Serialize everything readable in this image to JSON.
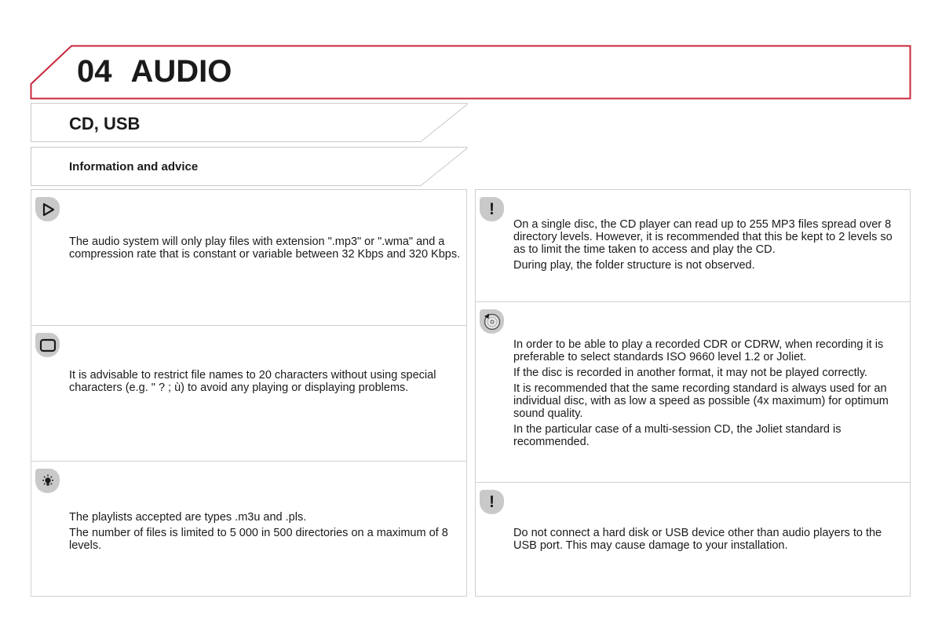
{
  "chapter": {
    "number": "04",
    "title": "AUDIO",
    "accent_color": "#c8283c"
  },
  "section": {
    "title": "CD, USB"
  },
  "subsection": {
    "title": "Information and advice"
  },
  "left_panels": [
    {
      "icon": "play-triangle-icon",
      "paragraphs": [
        "The audio system will only play files with extension \".mp3\" or \".wma\" and a compression rate that is constant or variable between 32 Kbps and 320 Kbps."
      ]
    },
    {
      "icon": "rounded-square-icon",
      "paragraphs": [
        "It is advisable to restrict file names to 20 characters without using special characters (e.g. \" ? ; ù) to avoid any playing or displaying problems."
      ]
    },
    {
      "icon": "lightbulb-icon",
      "paragraphs": [
        "The playlists accepted are types .m3u and .pls.",
        "The number of files is limited to 5 000 in 500 directories on a maximum of 8 levels."
      ]
    }
  ],
  "right_panels": [
    {
      "icon": "exclamation-icon",
      "icon_glyph": "!",
      "paragraphs": [
        "On a single disc, the CD player can read up to 255 MP3 files spread over 8 directory levels. However, it is recommended that this be kept to 2 levels so as to limit the time taken to access and play the CD.",
        "During play, the folder structure is not observed."
      ]
    },
    {
      "icon": "disc-recording-icon",
      "paragraphs": [
        "In order to be able to play a recorded CDR or CDRW, when recording it is preferable to select standards ISO 9660 level 1.2 or Joliet.",
        "If the disc is recorded in another format, it may not be played correctly.",
        "It is recommended that the same recording standard is always used for an individual disc, with as low a speed as possible (4x maximum) for optimum sound quality.",
        "In the particular case of a multi-session CD, the Joliet standard is recommended."
      ]
    },
    {
      "icon": "exclamation-icon",
      "icon_glyph": "!",
      "paragraphs": [
        "Do not connect a hard disk or USB device other than audio players to the USB port. This may cause damage to your installation."
      ]
    }
  ]
}
